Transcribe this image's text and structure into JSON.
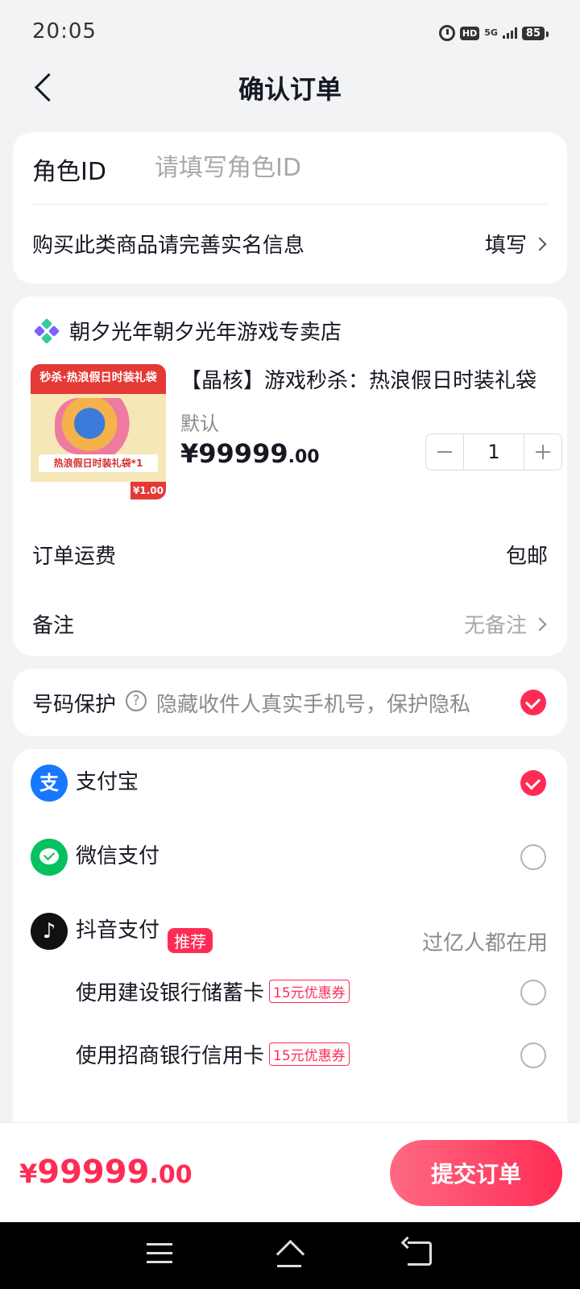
{
  "status_bar": {
    "time": "20:05",
    "hd": "HD",
    "network": "5G",
    "battery": "85"
  },
  "header": {
    "title": "确认订单"
  },
  "role": {
    "label": "角色ID",
    "placeholder": "请填写角色ID",
    "value": ""
  },
  "realname": {
    "label": "购买此类商品请完善实名信息",
    "action": "填写"
  },
  "shop": {
    "name": "朝夕光年朝夕光年游戏专卖店",
    "icon": "shop-logo-icon"
  },
  "product": {
    "image_banner": "秒杀·热浪假日时装礼袋",
    "image_caption": "热浪假日时装礼袋*1",
    "image_price": "¥1.00",
    "title": "【晶核】游戏秒杀：热浪假日时装礼袋",
    "spec": "默认",
    "price_int": "¥99999",
    "price_dec": ".00",
    "quantity": "1"
  },
  "shipping": {
    "label": "订单运费",
    "value": "包邮"
  },
  "note": {
    "label": "备注",
    "value": "无备注"
  },
  "number_protect": {
    "label": "号码保护",
    "help": "?",
    "description": "隐藏收件人真实手机号，保护隐私",
    "checked": true
  },
  "payment": {
    "alipay": {
      "label": "支付宝",
      "icon_text": "支",
      "checked": true
    },
    "wechat": {
      "label": "微信支付",
      "checked": false
    },
    "douyin": {
      "label": "抖音支付",
      "icon_text": "♪",
      "badge": "推荐",
      "right": "过亿人都在用"
    },
    "ccb": {
      "label": "使用建设银行储蓄卡",
      "coupon": "15元优惠券",
      "checked": false
    },
    "cmb": {
      "label": "使用招商银行信用卡",
      "coupon": "15元优惠券",
      "checked": false
    }
  },
  "bottom": {
    "currency": "¥",
    "total_int": "99999",
    "total_dec": ".00",
    "submit": "提交订单"
  },
  "colors": {
    "accent": "#fe2c55",
    "alipay": "#1677ff",
    "wechat": "#07c160"
  }
}
